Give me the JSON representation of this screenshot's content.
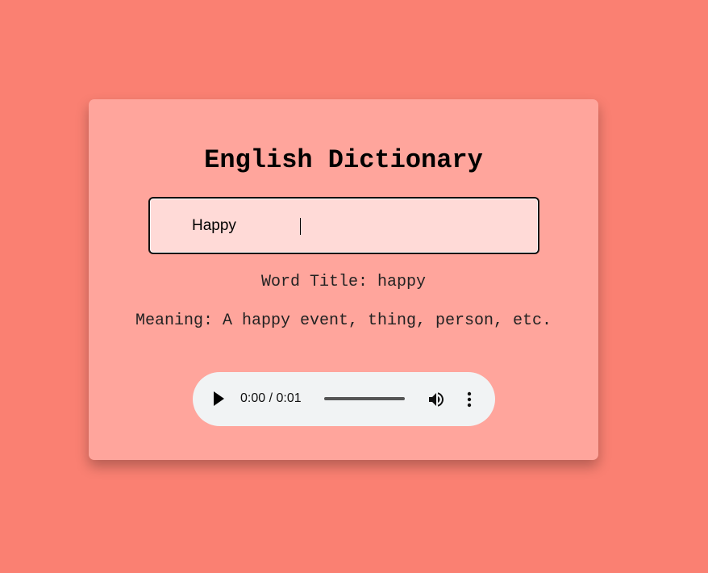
{
  "app": {
    "title": "English Dictionary"
  },
  "search": {
    "value": "Happy",
    "placeholder": ""
  },
  "result": {
    "word_title": "Word Title: happy",
    "meaning": "Meaning: A happy event, thing, person, etc."
  },
  "audio_player": {
    "time": "0:00 / 0:01",
    "play_icon": "play-icon",
    "volume_icon": "volume-icon",
    "more_icon": "more-vertical-icon",
    "progress": 0
  },
  "colors": {
    "background": "#fa8072",
    "card": "#ffa59c",
    "input": "#ffdad7",
    "player": "#f1f3f4"
  }
}
